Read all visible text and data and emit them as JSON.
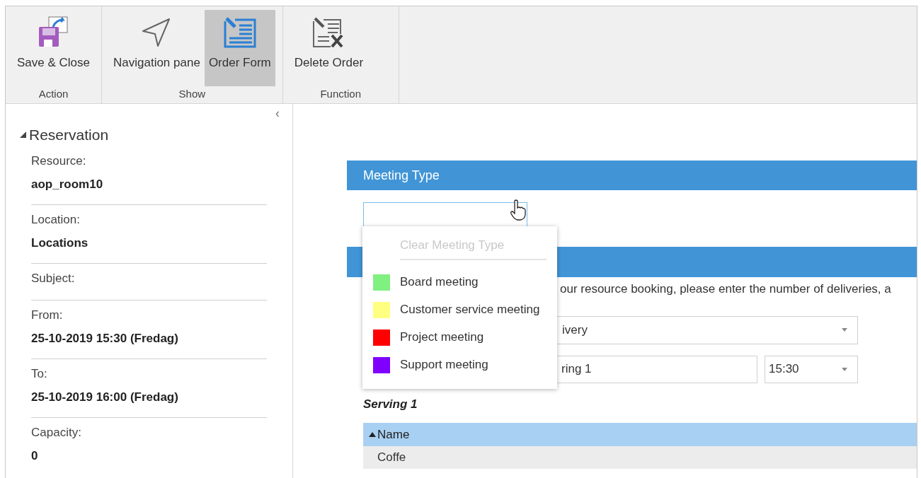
{
  "ribbon": {
    "groups": [
      {
        "label": "Action",
        "buttons": [
          {
            "kind": "save",
            "label": "Save & Close",
            "selected": false
          }
        ]
      },
      {
        "label": "Show",
        "buttons": [
          {
            "kind": "navigate",
            "label": "Navigation pane",
            "selected": false
          },
          {
            "kind": "form",
            "label": "Order Form",
            "selected": true
          }
        ]
      },
      {
        "label": "Function",
        "buttons": [
          {
            "kind": "delete",
            "label": "Delete Order",
            "selected": false
          }
        ]
      }
    ]
  },
  "sidebar": {
    "collapse": "‹",
    "section": {
      "title": "Reservation",
      "expanded": true
    },
    "fields": [
      {
        "label": "Resource:",
        "value": "aop_room10"
      },
      {
        "label": "Location:",
        "value": "Locations"
      },
      {
        "label": "Subject:"
      },
      {
        "label": "From:",
        "value": "25-10-2019 15:30 (Fredag)"
      },
      {
        "label": "To:",
        "value": "25-10-2019 16:00 (Fredag)"
      },
      {
        "label": "Capacity:",
        "value": "0"
      }
    ]
  },
  "form": {
    "meeting_type_header": "Meeting Type",
    "meeting_type_menu": {
      "clear": {
        "label": "Clear Meeting Type",
        "disabled": true
      },
      "options": [
        {
          "label": "Board meeting",
          "color": "#80f080",
          "disabled": false
        },
        {
          "label": "Customer service meeting",
          "color": "#ffff80",
          "disabled": false
        },
        {
          "label": "Project meeting",
          "color": "#ff0000",
          "disabled": false
        },
        {
          "label": "Support meeting",
          "color": "#8000ff",
          "disabled": false
        }
      ]
    },
    "description": "our resource booking, please enter the number of deliveries, a",
    "delivery_select": "ivery",
    "serving_field": "ring 1",
    "time_select": "15:30",
    "serving_title": "Serving 1",
    "table": {
      "columns": [
        {
          "label": "Name",
          "sorted_ascending": true
        }
      ],
      "rows": [
        [
          "Coffe"
        ]
      ]
    }
  }
}
